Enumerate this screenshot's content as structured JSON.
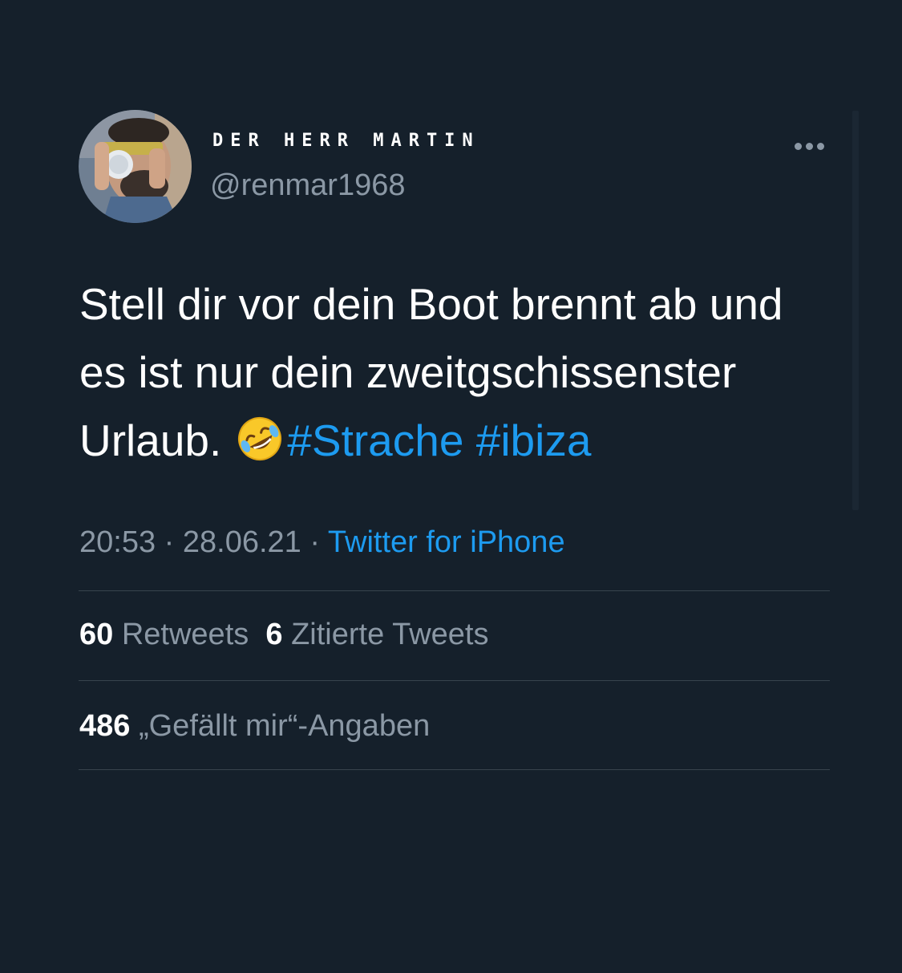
{
  "author": {
    "display_name": "DER HERR MARTIN",
    "handle": "@renmar1968",
    "avatar_icon": "profile-photo"
  },
  "menu": {
    "more_icon": "more-dots-icon"
  },
  "tweet": {
    "line1": "Stell dir vor dein Boot brennt ab und",
    "line2": "es ist nur dein zweitgschissenster",
    "line3": "Urlaub.",
    "emoji_icon": "rolling-on-the-floor-laughing-emoji",
    "hashtags": [
      "#Strache",
      "#ibiza"
    ]
  },
  "meta": {
    "time": "20:53",
    "separator": "·",
    "date": "28.06.21",
    "source": "Twitter for iPhone"
  },
  "stats": {
    "retweets_count": "60",
    "retweets_label": "Retweets",
    "quotes_count": "6",
    "quotes_label": "Zitierte Tweets",
    "likes_count": "486",
    "likes_label": "„Gefällt mir“-Angaben"
  },
  "colors": {
    "background": "#15202b",
    "accent": "#1d9bf0",
    "secondary_text": "#8b98a5",
    "divider": "#38444d"
  }
}
